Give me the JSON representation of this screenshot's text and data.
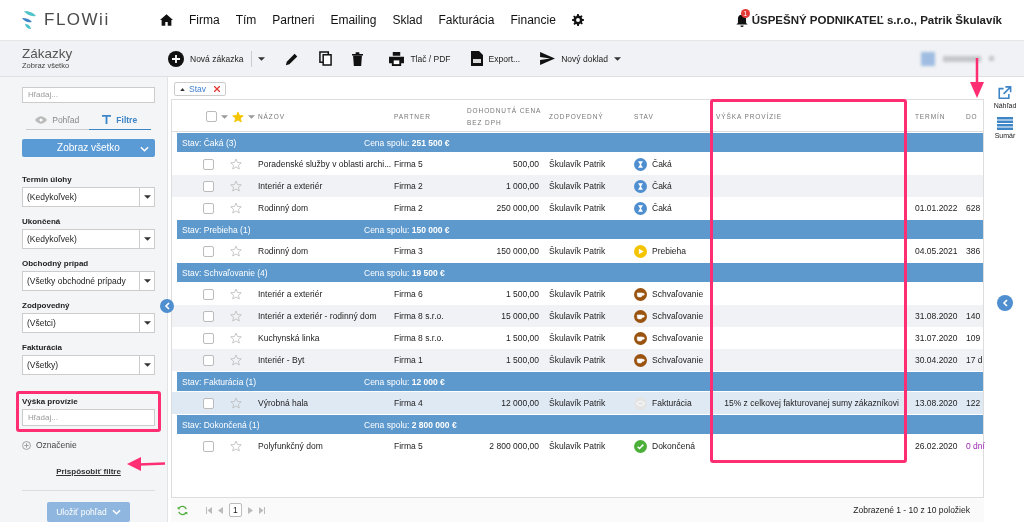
{
  "app": {
    "logo": "FLOWii"
  },
  "nav": {
    "items": [
      "Firma",
      "Tím",
      "Partneri",
      "Emailing",
      "Sklad",
      "Fakturácia",
      "Financie"
    ],
    "notifications": "1",
    "account": "ÚSPEŠNÝ PODNIKATEĽ s.r.o., Patrik Škulavík"
  },
  "page": {
    "title": "Zákazky",
    "subtitle": "Zobraz všetko"
  },
  "toolbar": [
    {
      "kind": "new",
      "label": "Nová zákazka"
    },
    {
      "kind": "split"
    },
    {
      "kind": "edit"
    },
    {
      "kind": "copy"
    },
    {
      "kind": "delete"
    },
    {
      "kind": "print",
      "label": "Tlač / PDF"
    },
    {
      "kind": "export",
      "label": "Export..."
    },
    {
      "kind": "document",
      "label": "Nový doklad"
    }
  ],
  "sidebar": {
    "search_placeholder": "Hľadaj...",
    "tabs": [
      {
        "label": "Pohľad",
        "selected": false
      },
      {
        "label": "Filtre",
        "selected": true
      }
    ],
    "view_button": "Zobraz všetko",
    "filters": [
      {
        "kind": "select",
        "label": "Termín úlohy",
        "value": "(Kedykoľvek)",
        "highlighted": false
      },
      {
        "kind": "select",
        "label": "Ukončená",
        "value": "(Kedykoľvek)",
        "highlighted": false
      },
      {
        "kind": "select",
        "label": "Obchodný prípad",
        "value": "(Všetky obchodné prípady",
        "highlighted": false
      },
      {
        "kind": "select",
        "label": "Zodpovedný",
        "value": "(Všetci)",
        "highlighted": false
      },
      {
        "kind": "select",
        "label": "Fakturácia",
        "value": "(Všetky)",
        "highlighted": false
      },
      {
        "kind": "text",
        "label": "Výška provízie",
        "placeholder": "Hľadaj...",
        "highlighted": true
      }
    ],
    "add_filter": "Označenie",
    "customize_link": {
      "label": "Prispôsobiť filtre",
      "pointer": true
    },
    "save_button": {
      "label": "Uložiť pohľad",
      "disabled": true
    }
  },
  "grouping": {
    "chip": "Stav"
  },
  "table": {
    "select_all_checked": false,
    "columns": [
      {
        "label": "NÁZOV",
        "highlighted": false,
        "pointer": false
      },
      {
        "label": "PARTNER",
        "highlighted": false,
        "pointer": false
      },
      {
        "label": "DOHODNUTÁ CENA BEZ DPH",
        "highlighted": false,
        "pointer": false
      },
      {
        "label": "ZODPOVEDNÝ",
        "highlighted": false,
        "pointer": false
      },
      {
        "label": "STAV",
        "highlighted": false,
        "pointer": false
      },
      {
        "label": "VÝŠKA PROVÍZIE",
        "highlighted": true,
        "pointer": false
      },
      {
        "label": "TERMÍN",
        "highlighted": false,
        "pointer": false
      },
      {
        "label": "DO",
        "highlighted": false,
        "pointer": true
      }
    ],
    "groups": [
      {
        "label": "Stav: Čaká (3)",
        "total_label": "Cena spolu:",
        "total": "251 500 €",
        "rows": [
          {
            "checked": false,
            "starred": false,
            "selected": false,
            "name": "Poradenské služby v oblasti archi...",
            "partner": "Firma 5",
            "price": "500,00",
            "responsible": "Škulavík Patrik",
            "status": {
              "kind": "waiting",
              "label": "Čaká"
            }
          },
          {
            "checked": false,
            "starred": false,
            "selected": false,
            "name": "Interiér a exteriér",
            "partner": "Firma 2",
            "price": "1 000,00",
            "responsible": "Škulavík Patrik",
            "status": {
              "kind": "waiting",
              "label": "Čaká"
            }
          },
          {
            "checked": false,
            "starred": false,
            "selected": false,
            "name": "Rodinný dom",
            "partner": "Firma 2",
            "price": "250 000,00",
            "responsible": "Škulavík Patrik",
            "status": {
              "kind": "waiting",
              "label": "Čaká"
            },
            "deadline": "01.01.2022",
            "remaining": "628",
            "remaining_alert": false
          }
        ]
      },
      {
        "label": "Stav: Prebieha (1)",
        "total_label": "Cena spolu:",
        "total": "150 000 €",
        "rows": [
          {
            "checked": false,
            "starred": false,
            "selected": false,
            "name": "Rodinný dom",
            "partner": "Firma 3",
            "price": "150 000,00",
            "responsible": "Škulavík Patrik",
            "status": {
              "kind": "running",
              "label": "Prebieha"
            },
            "deadline": "04.05.2021",
            "remaining": "386",
            "remaining_alert": false
          }
        ]
      },
      {
        "label": "Stav: Schvaľovanie (4)",
        "total_label": "Cena spolu:",
        "total": "19 500 €",
        "rows": [
          {
            "checked": false,
            "starred": false,
            "selected": false,
            "name": "Interiér a exteriér",
            "partner": "Firma 6",
            "price": "1 500,00",
            "responsible": "Škulavík Patrik",
            "status": {
              "kind": "approval",
              "label": "Schvaľovanie"
            }
          },
          {
            "checked": false,
            "starred": false,
            "selected": false,
            "name": "Interiér a exteriér - rodinný dom",
            "partner": "Firma 8 s.r.o.",
            "price": "15 000,00",
            "responsible": "Škulavík Patrik",
            "status": {
              "kind": "approval",
              "label": "Schvaľovanie"
            },
            "deadline": "31.08.2020",
            "remaining": "140",
            "remaining_alert": false
          },
          {
            "checked": false,
            "starred": false,
            "selected": false,
            "name": "Kuchynská linka",
            "partner": "Firma 8 s.r.o.",
            "price": "1 500,00",
            "responsible": "Škulavík Patrik",
            "status": {
              "kind": "approval",
              "label": "Schvaľovanie"
            },
            "deadline": "31.07.2020",
            "remaining": "109",
            "remaining_alert": false
          },
          {
            "checked": false,
            "starred": false,
            "selected": false,
            "name": "Interiér - Byt",
            "partner": "Firma 1",
            "price": "1 500,00",
            "responsible": "Škulavík Patrik",
            "status": {
              "kind": "approval",
              "label": "Schvaľovanie"
            },
            "deadline": "30.04.2020",
            "remaining": "17 d",
            "remaining_alert": false
          }
        ]
      },
      {
        "label": "Stav: Fakturácia (1)",
        "total_label": "Cena spolu:",
        "total": "12 000 €",
        "rows": [
          {
            "checked": false,
            "starred": false,
            "selected": true,
            "name": "Výrobná hala",
            "partner": "Firma 4",
            "price": "12 000,00",
            "responsible": "Škulavík Patrik",
            "status": {
              "kind": "invoicing",
              "label": "Fakturácia"
            },
            "commission": "15% z celkovej fakturovanej sumy zákazníkovi",
            "deadline": "13.08.2020",
            "remaining": "122",
            "remaining_alert": false
          }
        ]
      },
      {
        "label": "Stav: Dokončená (1)",
        "total_label": "Cena spolu:",
        "total": "2 800 000 €",
        "rows": [
          {
            "checked": false,
            "starred": false,
            "selected": false,
            "name": "Polyfunkčný dom",
            "partner": "Firma 5",
            "price": "2 800 000,00",
            "responsible": "Škulavík Patrik",
            "status": {
              "kind": "done",
              "label": "Dokončená"
            },
            "deadline": "26.02.2020",
            "remaining": "0 dní",
            "remaining_alert": true
          }
        ]
      }
    ]
  },
  "footer": {
    "page": "1",
    "summary": "Zobrazené 1 - 10 z 10 položiek"
  },
  "side_panel": [
    {
      "kind": "preview",
      "label": "Náhľad"
    },
    {
      "kind": "summary",
      "label": "Sumár"
    }
  ]
}
